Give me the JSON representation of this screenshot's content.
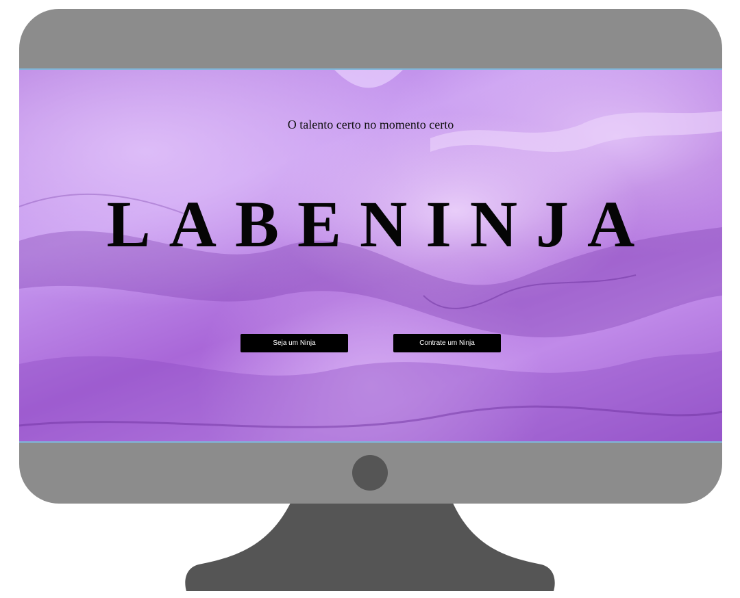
{
  "hero": {
    "tagline": "O talento certo no momento certo",
    "brand": "LABENINJA",
    "buttons": {
      "join_label": "Seja um Ninja",
      "hire_label": "Contrate um Ninja"
    }
  },
  "colors": {
    "bezel": "#8c8c8c",
    "stand": "#555555",
    "accent_purple": "#b57ee0",
    "button_bg": "#000000",
    "button_text": "#ffffff"
  },
  "icons": {
    "power": "power-button-icon"
  }
}
